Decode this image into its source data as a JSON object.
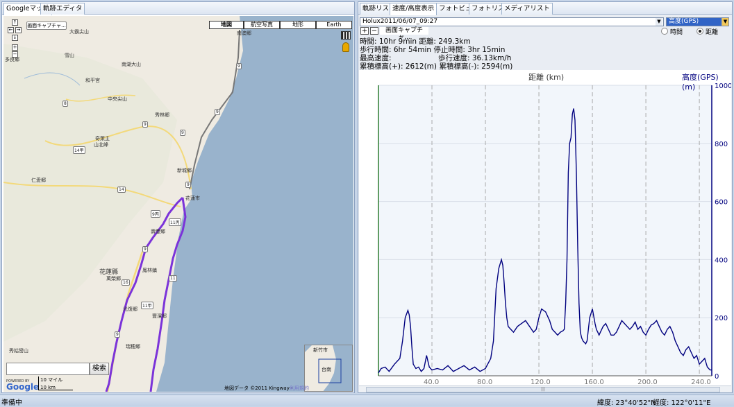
{
  "left_tabs": [
    "Googleマップ",
    "軌跡エディタ"
  ],
  "right_tabs": [
    "軌跡リスト",
    "速度/高度表示",
    "フォトビュー",
    "フォトリスト",
    "メディアリスト"
  ],
  "map": {
    "capture_label": "画面キャプチャ...",
    "type_buttons": [
      "地図",
      "航空写真",
      "地形",
      "Earth"
    ],
    "search_button": "検索",
    "scale_mile": "10 マイル",
    "scale_km": "10 km",
    "copyright": "地図データ ©2011 Kingway -",
    "terms_link": "利用規約",
    "place_labels": [
      {
        "id": "p1",
        "text": "大霸尖山"
      },
      {
        "id": "p2",
        "text": "雪山"
      },
      {
        "id": "p3",
        "text": "和平宮"
      },
      {
        "id": "p4",
        "text": "南湖大山"
      },
      {
        "id": "p5",
        "text": "中央尖山"
      },
      {
        "id": "p6",
        "text": "秀林郷"
      },
      {
        "id": "p7",
        "text": "奇萊主"
      },
      {
        "id": "p8",
        "text": "山北峰"
      },
      {
        "id": "p9",
        "text": "新城郷"
      },
      {
        "id": "p10",
        "text": "仁愛郷"
      },
      {
        "id": "p11",
        "text": "吉安郷"
      },
      {
        "id": "p12",
        "text": "壽豐郷"
      },
      {
        "id": "p13",
        "text": "花蓮縣"
      },
      {
        "id": "p14",
        "text": "鳳林鎮"
      },
      {
        "id": "p15",
        "text": "萬榮郷"
      },
      {
        "id": "p16",
        "text": "光復郷"
      },
      {
        "id": "p17",
        "text": "豐濱郷"
      },
      {
        "id": "p18",
        "text": "瑞穂郷"
      },
      {
        "id": "p19",
        "text": "秀姑巒山"
      },
      {
        "id": "p20",
        "text": "南澳郷"
      },
      {
        "id": "p21",
        "text": "花蓮市"
      },
      {
        "id": "p22",
        "text": "多良郷"
      },
      {
        "id": "p23",
        "text": "台南"
      },
      {
        "id": "p24",
        "text": "新竹市"
      }
    ],
    "powered_by": "POWERED BY",
    "google_logo": "Google"
  },
  "track": {
    "selected": "Holux2011/06/07_09:27",
    "y_select": "高度(GPS)",
    "capture_label": "画面キャプチャ...",
    "radio_time": "時間",
    "radio_distance": "距離",
    "radio_selected": "距離"
  },
  "stats": {
    "line1": "時間: 10hr 9min  距離: 249.3km",
    "line2": "歩行時間: 6hr 54min  停止時間: 3hr 15min",
    "line3a": "最高速度:",
    "line3b": "歩行速度: 36.13km/h",
    "line4": "累積標高(+): 2612(m)  累積標高(-): 2594(m)"
  },
  "chart_data": {
    "type": "line",
    "xlabel": "距離 (km)",
    "ylabel": "高度(GPS)(m)",
    "xlim": [
      0,
      249.3
    ],
    "ylim": [
      0,
      1000
    ],
    "x_ticks": [
      "40.0",
      "80.0",
      "120.0",
      "160.0",
      "200.0",
      "240.0"
    ],
    "x_tick_values": [
      40,
      80,
      120,
      160,
      200,
      240
    ],
    "y_ticks": [
      "0",
      "200",
      "400",
      "600",
      "800",
      "1000"
    ],
    "y_tick_values": [
      0,
      200,
      400,
      600,
      800,
      1000
    ],
    "series": [
      {
        "color": "#00007f",
        "x": [
          0,
          2,
          5,
          8,
          12,
          16,
          18,
          20,
          22,
          23,
          24,
          25,
          26,
          28,
          30,
          32,
          34,
          36,
          38,
          40,
          44,
          48,
          52,
          56,
          60,
          64,
          68,
          72,
          76,
          80,
          84,
          86,
          88,
          90,
          92,
          93,
          94,
          95,
          96,
          97,
          99,
          101,
          104,
          107,
          110,
          113,
          116,
          118,
          120,
          122,
          125,
          128,
          130,
          132,
          134,
          136,
          138,
          139,
          140,
          141,
          142,
          143,
          144,
          145,
          146,
          147,
          148,
          149,
          150,
          151,
          152,
          153,
          154,
          155,
          156,
          158,
          160,
          162,
          163,
          164,
          165,
          166,
          168,
          170,
          172,
          174,
          176,
          178,
          180,
          182,
          184,
          186,
          188,
          190,
          192,
          194,
          196,
          198,
          200,
          202,
          204,
          206,
          208,
          210,
          212,
          214,
          216,
          218,
          220,
          222,
          224,
          226,
          228,
          230,
          232,
          234,
          236,
          238,
          240,
          242,
          244,
          246,
          248,
          249.3
        ],
        "y": [
          10,
          25,
          30,
          15,
          40,
          60,
          120,
          200,
          225,
          210,
          170,
          100,
          40,
          25,
          30,
          15,
          25,
          70,
          30,
          20,
          25,
          20,
          35,
          15,
          25,
          35,
          20,
          30,
          15,
          25,
          60,
          120,
          300,
          370,
          400,
          380,
          320,
          250,
          200,
          170,
          160,
          150,
          170,
          180,
          190,
          170,
          150,
          160,
          200,
          230,
          220,
          190,
          160,
          150,
          140,
          150,
          155,
          160,
          250,
          400,
          700,
          800,
          820,
          900,
          920,
          880,
          700,
          450,
          250,
          150,
          130,
          120,
          115,
          110,
          120,
          200,
          230,
          180,
          160,
          150,
          140,
          150,
          170,
          180,
          160,
          140,
          140,
          150,
          170,
          190,
          180,
          170,
          160,
          170,
          185,
          160,
          170,
          150,
          140,
          160,
          175,
          180,
          190,
          170,
          150,
          140,
          160,
          170,
          150,
          120,
          100,
          80,
          70,
          90,
          100,
          80,
          60,
          70,
          40,
          50,
          60,
          30,
          20,
          20
        ]
      }
    ],
    "grid": true
  },
  "scrollbar_label": "|||",
  "status": {
    "left": "準備中",
    "lat": "緯度: 23°40'52\"N",
    "lon": "経度: 122°0'11\"E"
  }
}
